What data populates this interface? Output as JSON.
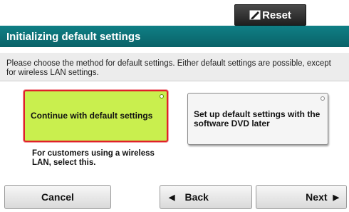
{
  "topbar": {
    "reset_label": "Reset",
    "reset_icon": "pencil-slash-icon"
  },
  "title": "Initializing default settings",
  "instructions": "Please choose the method for default settings. Either default settings are possible, except for wireless LAN settings.",
  "options": [
    {
      "label": "Continue with default settings",
      "selected": true
    },
    {
      "label": "Set up default settings with the software DVD later",
      "selected": false
    }
  ],
  "note": "For customers using a wireless LAN, select this.",
  "footer": {
    "cancel_label": "Cancel",
    "back_label": "Back",
    "back_icon": "triangle-left-icon",
    "next_label": "Next",
    "next_icon": "triangle-right-icon"
  },
  "colors": {
    "title_bar": "#0a6b72",
    "selected_option": "#c9ef4e",
    "selected_border": "#e0202a"
  }
}
